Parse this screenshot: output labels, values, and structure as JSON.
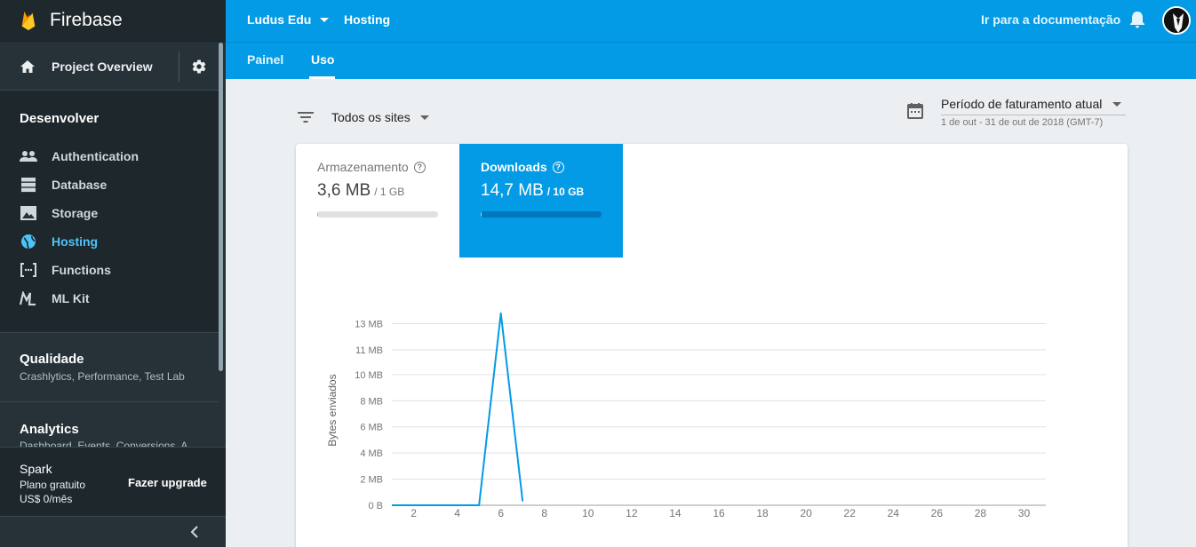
{
  "sidebar": {
    "brand": "Firebase",
    "overview": "Project Overview",
    "develop": {
      "title": "Desenvolver",
      "items": [
        {
          "label": "Authentication",
          "icon": "people-icon"
        },
        {
          "label": "Database",
          "icon": "database-icon"
        },
        {
          "label": "Storage",
          "icon": "storage-icon"
        },
        {
          "label": "Hosting",
          "icon": "globe-icon"
        },
        {
          "label": "Functions",
          "icon": "functions-icon"
        },
        {
          "label": "ML Kit",
          "icon": "mlkit-icon"
        }
      ]
    },
    "quality": {
      "title": "Qualidade",
      "subtitle": "Crashlytics, Performance, Test Lab"
    },
    "analytics": {
      "title": "Analytics",
      "subtitle": "Dashboard, Events, Conversions, A..."
    },
    "plan": {
      "name": "Spark",
      "type": "Plano gratuito",
      "price": "US$ 0/mês",
      "upgrade": "Fazer upgrade"
    }
  },
  "header": {
    "project": "Ludus Edu",
    "section": "Hosting",
    "docs": "Ir para a documentação",
    "tabs": [
      "Painel",
      "Uso"
    ],
    "accent": "#039be5"
  },
  "main": {
    "filter": "Todos os sites",
    "period": {
      "title": "Período de faturamento atual",
      "range": "1 de out - 31 de out de 2018 (GMT-7)"
    },
    "metrics": [
      {
        "label": "Armazenamento",
        "value": "3,6 MB",
        "limit": "/ 1 GB",
        "usage_fraction": 0.0036
      },
      {
        "label": "Downloads",
        "value": "14,7 MB",
        "limit": "/ 10 GB",
        "usage_fraction": 0.0015
      }
    ]
  },
  "chart_data": {
    "type": "line",
    "ylabel": "Bytes enviados",
    "yticks": [
      "0 B",
      "2 MB",
      "4 MB",
      "6 MB",
      "8 MB",
      "10 MB",
      "11 MB",
      "13 MB"
    ],
    "xticks": [
      "2",
      "4",
      "6",
      "8",
      "10",
      "12",
      "14",
      "16",
      "18",
      "20",
      "22",
      "24",
      "26",
      "28",
      "30"
    ],
    "x": [
      1,
      2,
      3,
      4,
      5,
      6,
      7
    ],
    "values_mb": [
      0,
      0,
      0,
      0,
      0,
      14.7,
      0.3
    ],
    "xlim": [
      1,
      31
    ],
    "ylim_mb": [
      0,
      14
    ],
    "grid": true,
    "color": "#039be5"
  }
}
